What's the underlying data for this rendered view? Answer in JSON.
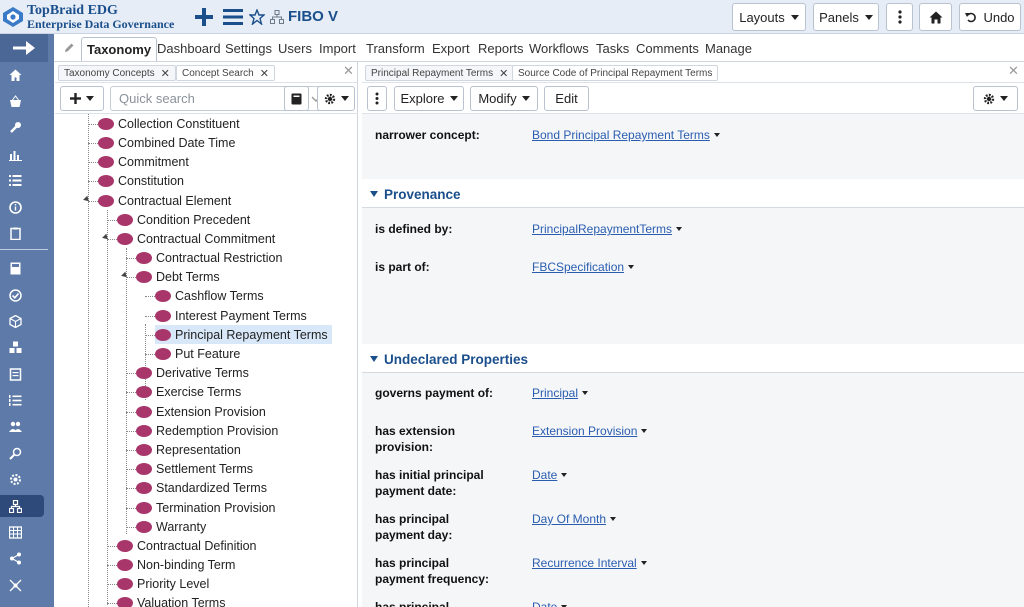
{
  "header": {
    "logo_line1": "TopBraid EDG",
    "logo_line2": "Enterprise Data Governance",
    "asset_title": "FIBO V",
    "buttons": {
      "layouts": "Layouts",
      "panels": "Panels",
      "undo": "Undo"
    }
  },
  "main_tabs": {
    "active": "Taxonomy",
    "others": [
      "Dashboard",
      "Settings",
      "Users",
      "Import",
      "Transform",
      "Export",
      "Reports",
      "Workflows",
      "Tasks",
      "Comments",
      "Manage"
    ]
  },
  "left_panel": {
    "tabs": [
      "Taxonomy Concepts",
      "Concept Search"
    ],
    "search_placeholder": "Quick search",
    "tree": [
      "Collection Constituent",
      "Combined Date Time",
      "Commitment",
      "Constitution",
      "Contractual Element",
      "Condition Precedent",
      "Contractual Commitment",
      "Contractual Restriction",
      "Debt Terms",
      "Cashflow Terms",
      "Interest Payment Terms",
      "Principal Repayment Terms",
      "Put Feature",
      "Derivative Terms",
      "Exercise Terms",
      "Extension Provision",
      "Redemption Provision",
      "Representation",
      "Settlement Terms",
      "Standardized Terms",
      "Termination Provision",
      "Warranty",
      "Contractual Definition",
      "Non-binding Term",
      "Priority Level",
      "Valuation Terms"
    ],
    "selected": "Principal Repayment Terms"
  },
  "right_panel": {
    "tabs": [
      "Principal Repayment Terms",
      "Source Code of Principal Repayment Terms"
    ],
    "toolbar": {
      "explore": "Explore",
      "modify": "Modify",
      "edit": "Edit"
    },
    "top_property": {
      "label": "narrower concept:",
      "value": "Bond Principal Repayment Terms"
    },
    "provenance": {
      "title": "Provenance",
      "props": [
        {
          "label": "is defined by:",
          "value": "PrincipalRepaymentTerms"
        },
        {
          "label": "is part of:",
          "value": "FBCSpecification"
        }
      ]
    },
    "undeclared": {
      "title": "Undeclared Properties",
      "props": [
        {
          "label": "governs payment of:",
          "value": "Principal"
        },
        {
          "label": "has extension provision:",
          "value": "Extension Provision"
        },
        {
          "label": "has initial principal payment date:",
          "value": "Date"
        },
        {
          "label": "has principal payment day:",
          "value": "Day Of Month"
        },
        {
          "label": "has principal payment frequency:",
          "value": "Recurrence Interval"
        },
        {
          "label": "has principal repayment date:",
          "value": "Date"
        }
      ]
    }
  },
  "icons": {
    "leftbar": [
      "home-icon",
      "basket-icon",
      "wrench-icon",
      "chart-icon",
      "list-icon",
      "info-icon",
      "clipboard-icon",
      "calculator-icon",
      "check-circle-icon",
      "cube-icon",
      "cubes-icon",
      "document-icon",
      "ordered-list-icon",
      "users-icon",
      "search-cog-icon",
      "settings-icon",
      "taxonomy-icon",
      "grid-icon",
      "share-icon",
      "connections-icon"
    ]
  },
  "colors": {
    "brand": "#1b4f8c",
    "leftbar": "#5d7aa8",
    "concept_dot": "#a8366a",
    "link": "#2a5db0",
    "selection": "#d8e8f8"
  }
}
